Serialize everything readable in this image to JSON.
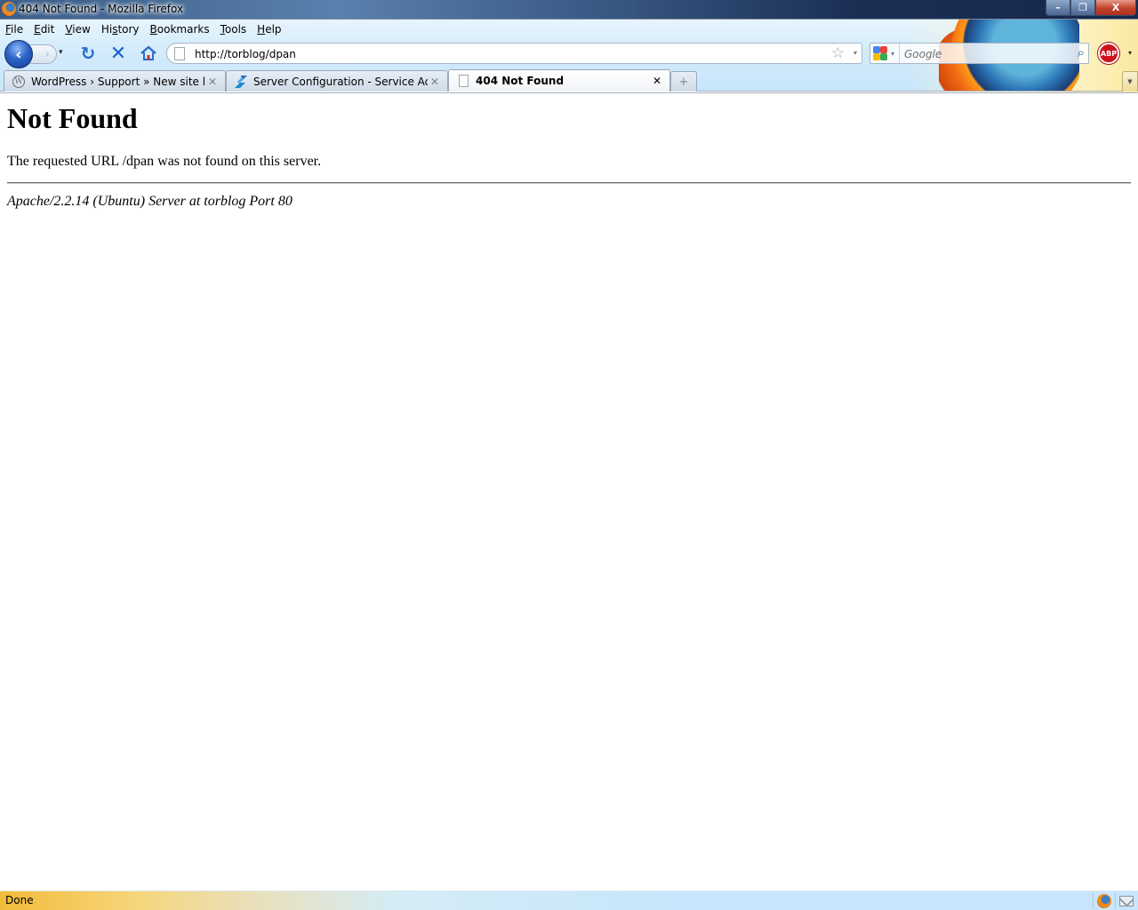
{
  "window": {
    "title": "404 Not Found - Mozilla Firefox",
    "controls": {
      "minimize": "–",
      "restore": "❐",
      "close": "X"
    }
  },
  "menu": [
    {
      "label": "File",
      "accel": "F",
      "rest": "ile"
    },
    {
      "label": "Edit",
      "accel": "E",
      "rest": "dit"
    },
    {
      "label": "View",
      "accel": "V",
      "rest": "iew"
    },
    {
      "label": "History",
      "accel": "s",
      "pre": "Hi",
      "rest": "tory"
    },
    {
      "label": "Bookmarks",
      "accel": "B",
      "rest": "ookmarks"
    },
    {
      "label": "Tools",
      "accel": "T",
      "rest": "ools"
    },
    {
      "label": "Help",
      "accel": "H",
      "rest": "elp"
    }
  ],
  "nav": {
    "back_glyph": "‹",
    "forward_glyph": "›",
    "dropdown_glyph": "▾",
    "reload_glyph": "↻",
    "stop_glyph": "✕",
    "url": "http://torblog/dpan",
    "bookmark_star": "☆",
    "url_dropdown": "▾"
  },
  "search": {
    "placeholder": "Google",
    "engine": "google-icon",
    "dropdown": "▾",
    "go_glyph": "⌕"
  },
  "addons": {
    "abp_label": "ABP",
    "abp_dropdown": "▾"
  },
  "tabs": [
    {
      "label": "WordPress › Support » New site lea...",
      "icon": "wordpress-icon",
      "active": false,
      "close": "✕"
    },
    {
      "label": "Server Configuration - Service Acco...",
      "icon": "service-config-icon",
      "active": false,
      "close": "✕"
    },
    {
      "label": "404 Not Found",
      "icon": "page-icon",
      "active": true,
      "close": "✕"
    }
  ],
  "tabstrip": {
    "new_tab_glyph": "+",
    "list_all_glyph": "▼"
  },
  "page": {
    "heading": "Not Found",
    "message": "The requested URL /dpan was not found on this server.",
    "server_signature": "Apache/2.2.14 (Ubuntu) Server at torblog Port 80"
  },
  "status": {
    "text": "Done"
  }
}
